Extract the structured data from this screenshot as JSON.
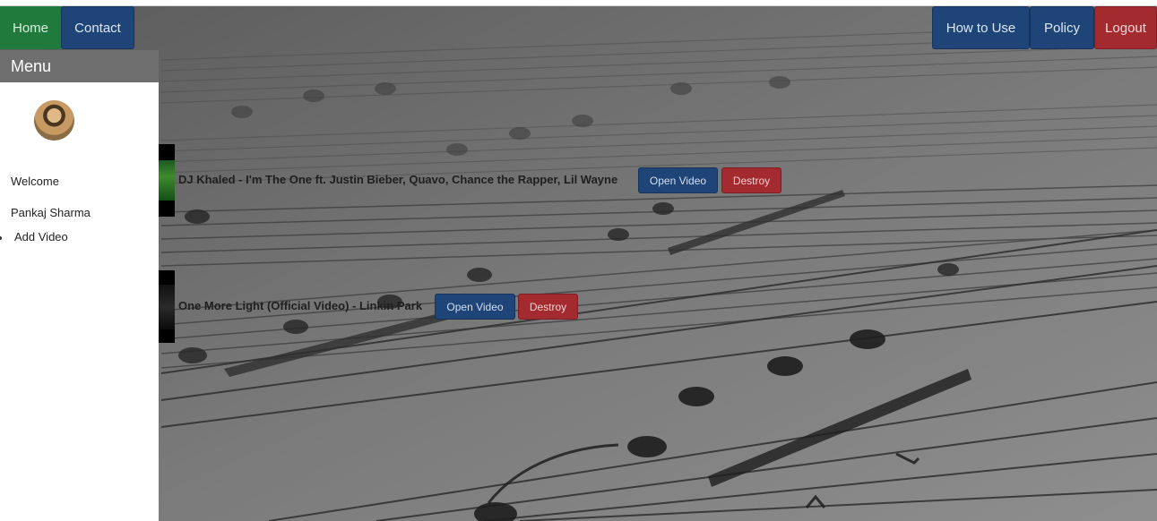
{
  "nav": {
    "home": "Home",
    "contact": "Contact",
    "how_to_use": "How to Use",
    "policy": "Policy",
    "logout": "Logout"
  },
  "sidebar": {
    "title": "Menu",
    "welcome": "Welcome",
    "user_name": "Pankaj Sharma",
    "add_video": "Add Video"
  },
  "videos": [
    {
      "title": "DJ Khaled - I'm The One ft. Justin Bieber, Quavo, Chance the Rapper, Lil Wayne",
      "open_label": "Open Video",
      "destroy_label": "Destroy"
    },
    {
      "title": "One More Light (Official Video) - Linkin Park",
      "open_label": "Open Video",
      "destroy_label": "Destroy"
    }
  ],
  "colors": {
    "primary": "#1f4578",
    "success": "#1f7a3c",
    "danger": "#a32a2f",
    "sidebar_header": "#6f6f6f"
  }
}
